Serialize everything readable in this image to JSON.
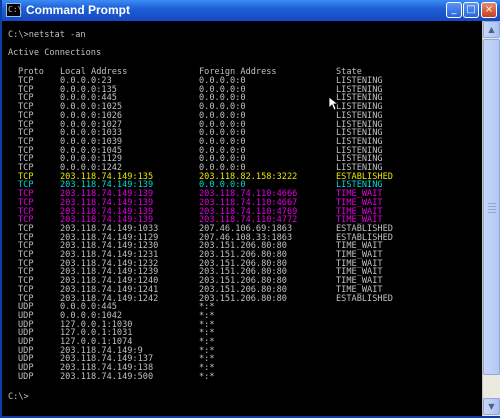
{
  "window": {
    "title": "Command Prompt",
    "icon_text": "C:\\",
    "buttons": {
      "minimize": "_",
      "maximize": "□",
      "close": "×"
    }
  },
  "colors": {
    "default": "#c0c0c0",
    "yellow": "#e8e800",
    "cyan": "#00d8d8",
    "magenta": "#e000e0"
  },
  "console": {
    "command_line": "C:\\>netstat -an",
    "section_title": "Active Connections",
    "headers": {
      "proto": "Proto",
      "local": "Local Address",
      "foreign": "Foreign Address",
      "state": "State"
    },
    "rows": [
      {
        "proto": "TCP",
        "local": "0.0.0.0:23",
        "foreign": "0.0.0.0:0",
        "state": "LISTENING",
        "color": "default"
      },
      {
        "proto": "TCP",
        "local": "0.0.0.0:135",
        "foreign": "0.0.0.0:0",
        "state": "LISTENING",
        "color": "default"
      },
      {
        "proto": "TCP",
        "local": "0.0.0.0:445",
        "foreign": "0.0.0.0:0",
        "state": "LISTENING",
        "color": "default"
      },
      {
        "proto": "TCP",
        "local": "0.0.0.0:1025",
        "foreign": "0.0.0.0:0",
        "state": "LISTENING",
        "color": "default"
      },
      {
        "proto": "TCP",
        "local": "0.0.0.0:1026",
        "foreign": "0.0.0.0:0",
        "state": "LISTENING",
        "color": "default"
      },
      {
        "proto": "TCP",
        "local": "0.0.0.0:1027",
        "foreign": "0.0.0.0:0",
        "state": "LISTENING",
        "color": "default"
      },
      {
        "proto": "TCP",
        "local": "0.0.0.0:1033",
        "foreign": "0.0.0.0:0",
        "state": "LISTENING",
        "color": "default"
      },
      {
        "proto": "TCP",
        "local": "0.0.0.0:1039",
        "foreign": "0.0.0.0:0",
        "state": "LISTENING",
        "color": "default"
      },
      {
        "proto": "TCP",
        "local": "0.0.0.0:1045",
        "foreign": "0.0.0.0:0",
        "state": "LISTENING",
        "color": "default"
      },
      {
        "proto": "TCP",
        "local": "0.0.0.0:1129",
        "foreign": "0.0.0.0:0",
        "state": "LISTENING",
        "color": "default"
      },
      {
        "proto": "TCP",
        "local": "0.0.0.0:1242",
        "foreign": "0.0.0.0:0",
        "state": "LISTENING",
        "color": "default"
      },
      {
        "proto": "TCP",
        "local": "203.118.74.149:135",
        "foreign": "203.118.82.158:3222",
        "state": "ESTABLISHED",
        "color": "yellow"
      },
      {
        "proto": "TCP",
        "local": "203.118.74.149:139",
        "foreign": "0.0.0.0:0",
        "state": "LISTENING",
        "color": "cyan"
      },
      {
        "proto": "TCP",
        "local": "203.118.74.149:139",
        "foreign": "203.118.74.110:4666",
        "state": "TIME_WAIT",
        "color": "magenta"
      },
      {
        "proto": "TCP",
        "local": "203.118.74.149:139",
        "foreign": "203.118.74.110:4667",
        "state": "TIME_WAIT",
        "color": "magenta"
      },
      {
        "proto": "TCP",
        "local": "203.118.74.149:139",
        "foreign": "203.118.74.110:4769",
        "state": "TIME_WAIT",
        "color": "magenta"
      },
      {
        "proto": "TCP",
        "local": "203.118.74.149:139",
        "foreign": "203.118.74.110:4772",
        "state": "TIME_WAIT",
        "color": "magenta"
      },
      {
        "proto": "TCP",
        "local": "203.118.74.149:1033",
        "foreign": "207.46.106.69:1863",
        "state": "ESTABLISHED",
        "color": "default"
      },
      {
        "proto": "TCP",
        "local": "203.118.74.149:1129",
        "foreign": "207.46.108.33:1863",
        "state": "ESTABLISHED",
        "color": "default"
      },
      {
        "proto": "TCP",
        "local": "203.118.74.149:1230",
        "foreign": "203.151.206.80:80",
        "state": "TIME_WAIT",
        "color": "default"
      },
      {
        "proto": "TCP",
        "local": "203.118.74.149:1231",
        "foreign": "203.151.206.80:80",
        "state": "TIME_WAIT",
        "color": "default"
      },
      {
        "proto": "TCP",
        "local": "203.118.74.149:1232",
        "foreign": "203.151.206.80:80",
        "state": "TIME_WAIT",
        "color": "default"
      },
      {
        "proto": "TCP",
        "local": "203.118.74.149:1239",
        "foreign": "203.151.206.80:80",
        "state": "TIME_WAIT",
        "color": "default"
      },
      {
        "proto": "TCP",
        "local": "203.118.74.149:1240",
        "foreign": "203.151.206.80:80",
        "state": "TIME_WAIT",
        "color": "default"
      },
      {
        "proto": "TCP",
        "local": "203.118.74.149:1241",
        "foreign": "203.151.206.80:80",
        "state": "TIME_WAIT",
        "color": "default"
      },
      {
        "proto": "TCP",
        "local": "203.118.74.149:1242",
        "foreign": "203.151.206.80:80",
        "state": "ESTABLISHED",
        "color": "default"
      },
      {
        "proto": "UDP",
        "local": "0.0.0.0:445",
        "foreign": "*:*",
        "state": "",
        "color": "default"
      },
      {
        "proto": "UDP",
        "local": "0.0.0.0:1042",
        "foreign": "*:*",
        "state": "",
        "color": "default"
      },
      {
        "proto": "UDP",
        "local": "127.0.0.1:1030",
        "foreign": "*:*",
        "state": "",
        "color": "default"
      },
      {
        "proto": "UDP",
        "local": "127.0.0.1:1031",
        "foreign": "*:*",
        "state": "",
        "color": "default"
      },
      {
        "proto": "UDP",
        "local": "127.0.0.1:1074",
        "foreign": "*:*",
        "state": "",
        "color": "default"
      },
      {
        "proto": "UDP",
        "local": "203.118.74.149:9",
        "foreign": "*:*",
        "state": "",
        "color": "default"
      },
      {
        "proto": "UDP",
        "local": "203.118.74.149:137",
        "foreign": "*:*",
        "state": "",
        "color": "default"
      },
      {
        "proto": "UDP",
        "local": "203.118.74.149:138",
        "foreign": "*:*",
        "state": "",
        "color": "default"
      },
      {
        "proto": "UDP",
        "local": "203.118.74.149:500",
        "foreign": "*:*",
        "state": "",
        "color": "default"
      }
    ],
    "prompt": "C:\\>"
  },
  "icons": {
    "cursor": "mouse-pointer-icon",
    "scroll_up": "scroll-up-arrow-icon",
    "scroll_down": "scroll-down-arrow-icon"
  }
}
